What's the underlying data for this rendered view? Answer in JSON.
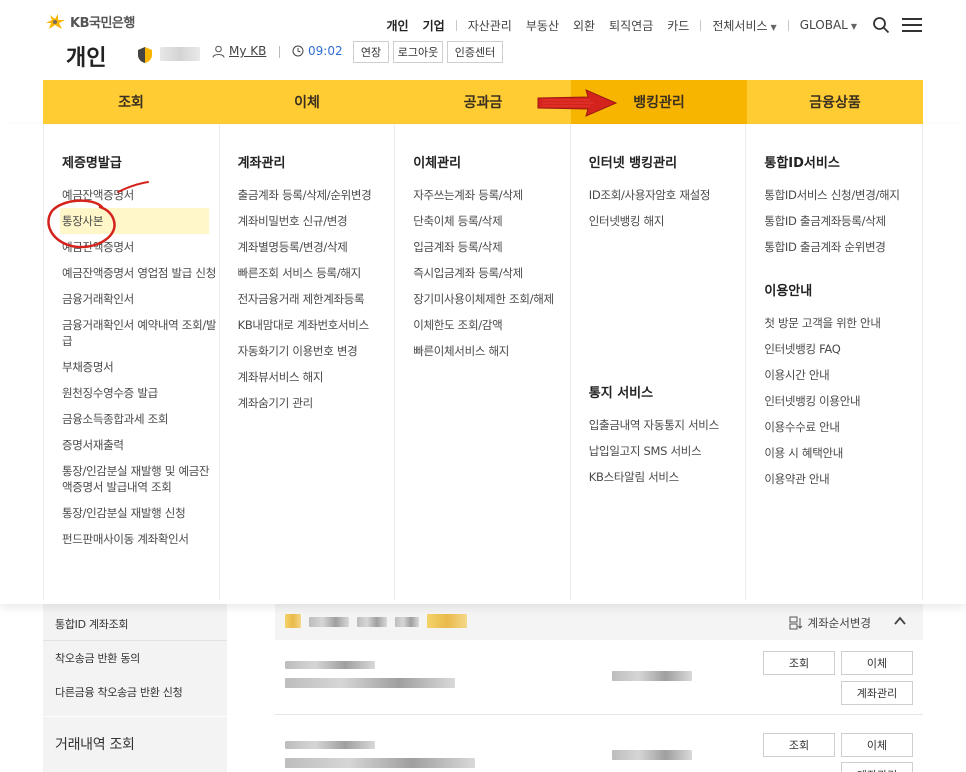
{
  "header": {
    "logo_text": "KB국민은행",
    "page_title": "개인",
    "my_kb": "My KB",
    "timer": "09:02",
    "buttons": [
      "연장",
      "로그아웃",
      "인증센터"
    ]
  },
  "top_nav": {
    "items": [
      "개인",
      "기업",
      "자산관리",
      "부동산",
      "외환",
      "퇴직연금",
      "카드",
      "전체서비스",
      "GLOBAL"
    ]
  },
  "main_nav": {
    "tabs": [
      "조회",
      "이체",
      "공과금",
      "뱅킹관리",
      "금융상품"
    ],
    "active": "뱅킹관리"
  },
  "mega_menu": {
    "col1": {
      "title": "제증명발급",
      "items": [
        "예금잔액증명서",
        "통장사본",
        "예금잔액증명서",
        "예금잔액증명서 영업점 발급 신청",
        "금융거래확인서",
        "금융거래확인서 예약내역 조회/발급",
        "부채증명서",
        "원천징수영수증 발급",
        "금융소득종합과세 조회",
        "증명서재출력",
        "통장/인감분실 재발행 및 예금잔액증명서 발급내역 조회",
        "통장/인감분실 재발행 신청",
        "펀드판매사이동 계좌확인서"
      ]
    },
    "col2": {
      "title": "계좌관리",
      "items": [
        "출금계좌 등록/삭제/순위변경",
        "계좌비밀번호 신규/변경",
        "계좌별명등록/변경/삭제",
        "빠른조회 서비스 등록/해지",
        "전자금융거래 제한계좌등록",
        "KB내맘대로 계좌번호서비스",
        "자동화기기 이용번호 변경",
        "계좌뷰서비스 해지",
        "계좌숨기기 관리"
      ]
    },
    "col3": {
      "title": "이체관리",
      "items": [
        "자주쓰는계좌 등록/삭제",
        "단축이체 등록/삭제",
        "입금계좌 등록/삭제",
        "즉시입금계좌 등록/삭제",
        "장기미사용이체제한 조회/해제",
        "이체한도 조회/감액",
        "빠른이체서비스 해지"
      ]
    },
    "col4": {
      "title": "인터넷 뱅킹관리",
      "items": [
        "ID조회/사용자암호 재설정",
        "인터넷뱅킹 해지"
      ],
      "title2": "통지 서비스",
      "items2": [
        "입출금내역 자동통지 서비스",
        "납입일고지 SMS 서비스",
        "KB스타알림 서비스"
      ]
    },
    "col5": {
      "title": "통합ID서비스",
      "items": [
        "통합ID서비스 신청/변경/해지",
        "통합ID 출금계좌등록/삭제",
        "통합ID 출금계좌 순위변경"
      ],
      "title2": "이용안내",
      "items2": [
        "첫 방문 고객을 위한 안내",
        "인터넷뱅킹 FAQ",
        "이용시간 안내",
        "인터넷뱅킹 이용안내",
        "이용수수료 안내",
        "이용 시 혜택안내",
        "이용약관 안내"
      ]
    }
  },
  "sidebar": {
    "items": [
      "통합ID 계좌조회",
      "착오송금 반환 동의",
      "다른금융 착오송금 반환 신청",
      "거래내역 조회"
    ]
  },
  "accounts": {
    "reorder_label": "계좌순서변경",
    "row_buttons": [
      "조회",
      "이체",
      "계좌관리"
    ]
  },
  "colors": {
    "nav_yellow": "#ffcc33",
    "nav_active": "#f7b500",
    "arrow_red": "#d4231c",
    "highlight": "#fff6c9",
    "timer_blue": "#2f6fd6"
  }
}
